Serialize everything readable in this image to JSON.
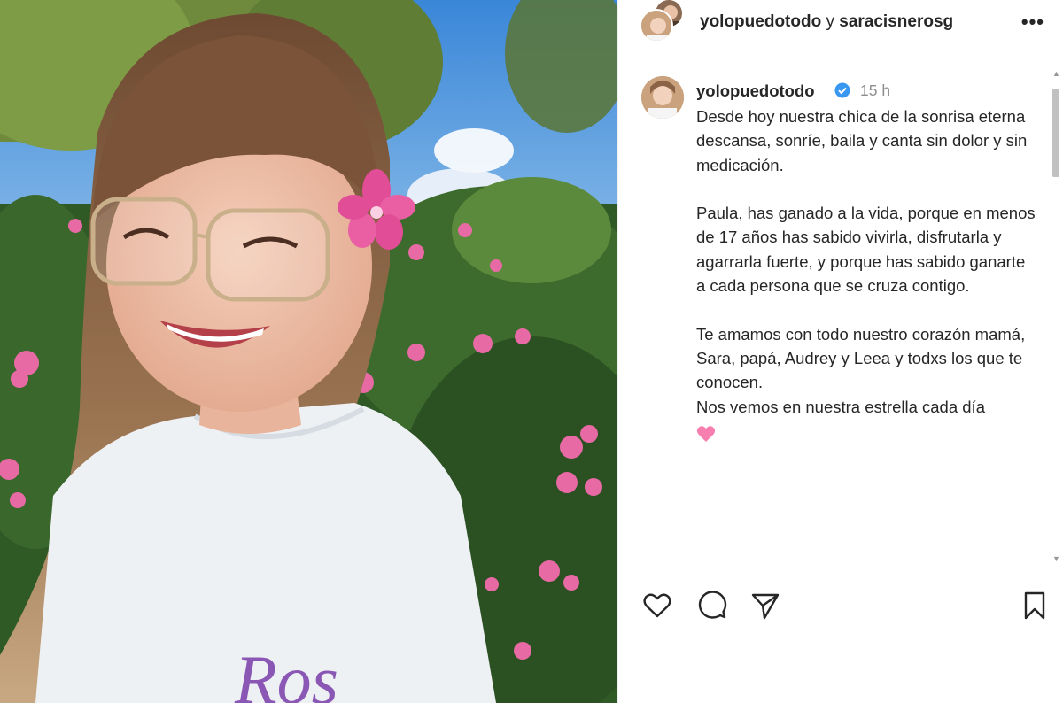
{
  "post": {
    "header": {
      "author": "yolopuedotodo",
      "connector": "y",
      "collaborator": "saracisnerosg",
      "more_label": "•••"
    },
    "caption": {
      "username": "yolopuedotodo",
      "time": "15 h",
      "paragraphs": [
        "Desde hoy nuestra chica de la sonrisa eterna descansa, sonríe, baila y canta sin dolor y sin medicación.",
        "Paula, has ganado a la vida, porque en menos de 17 años has sabido vivirla, disfrutarla y agarrarla fuerte, y porque has sabido ganarte a cada persona que se cruza contigo.",
        "Te amamos con todo nuestro corazón mamá, Sara, papá, Audrey y Leea y todxs los que te conocen.",
        "Nos vemos en nuestra estrella cada día"
      ],
      "emoji": "pink-heart",
      "sweater_text": "Ros"
    },
    "icons": {
      "like": "heart-outline-icon",
      "comment": "speech-bubble-icon",
      "share": "paper-plane-icon",
      "save": "bookmark-icon",
      "verified": "verified-badge-icon"
    },
    "colors": {
      "verified": "#3897f0",
      "emoji_heart": "#f77fb0",
      "muted_text": "#8e8e8e"
    }
  }
}
